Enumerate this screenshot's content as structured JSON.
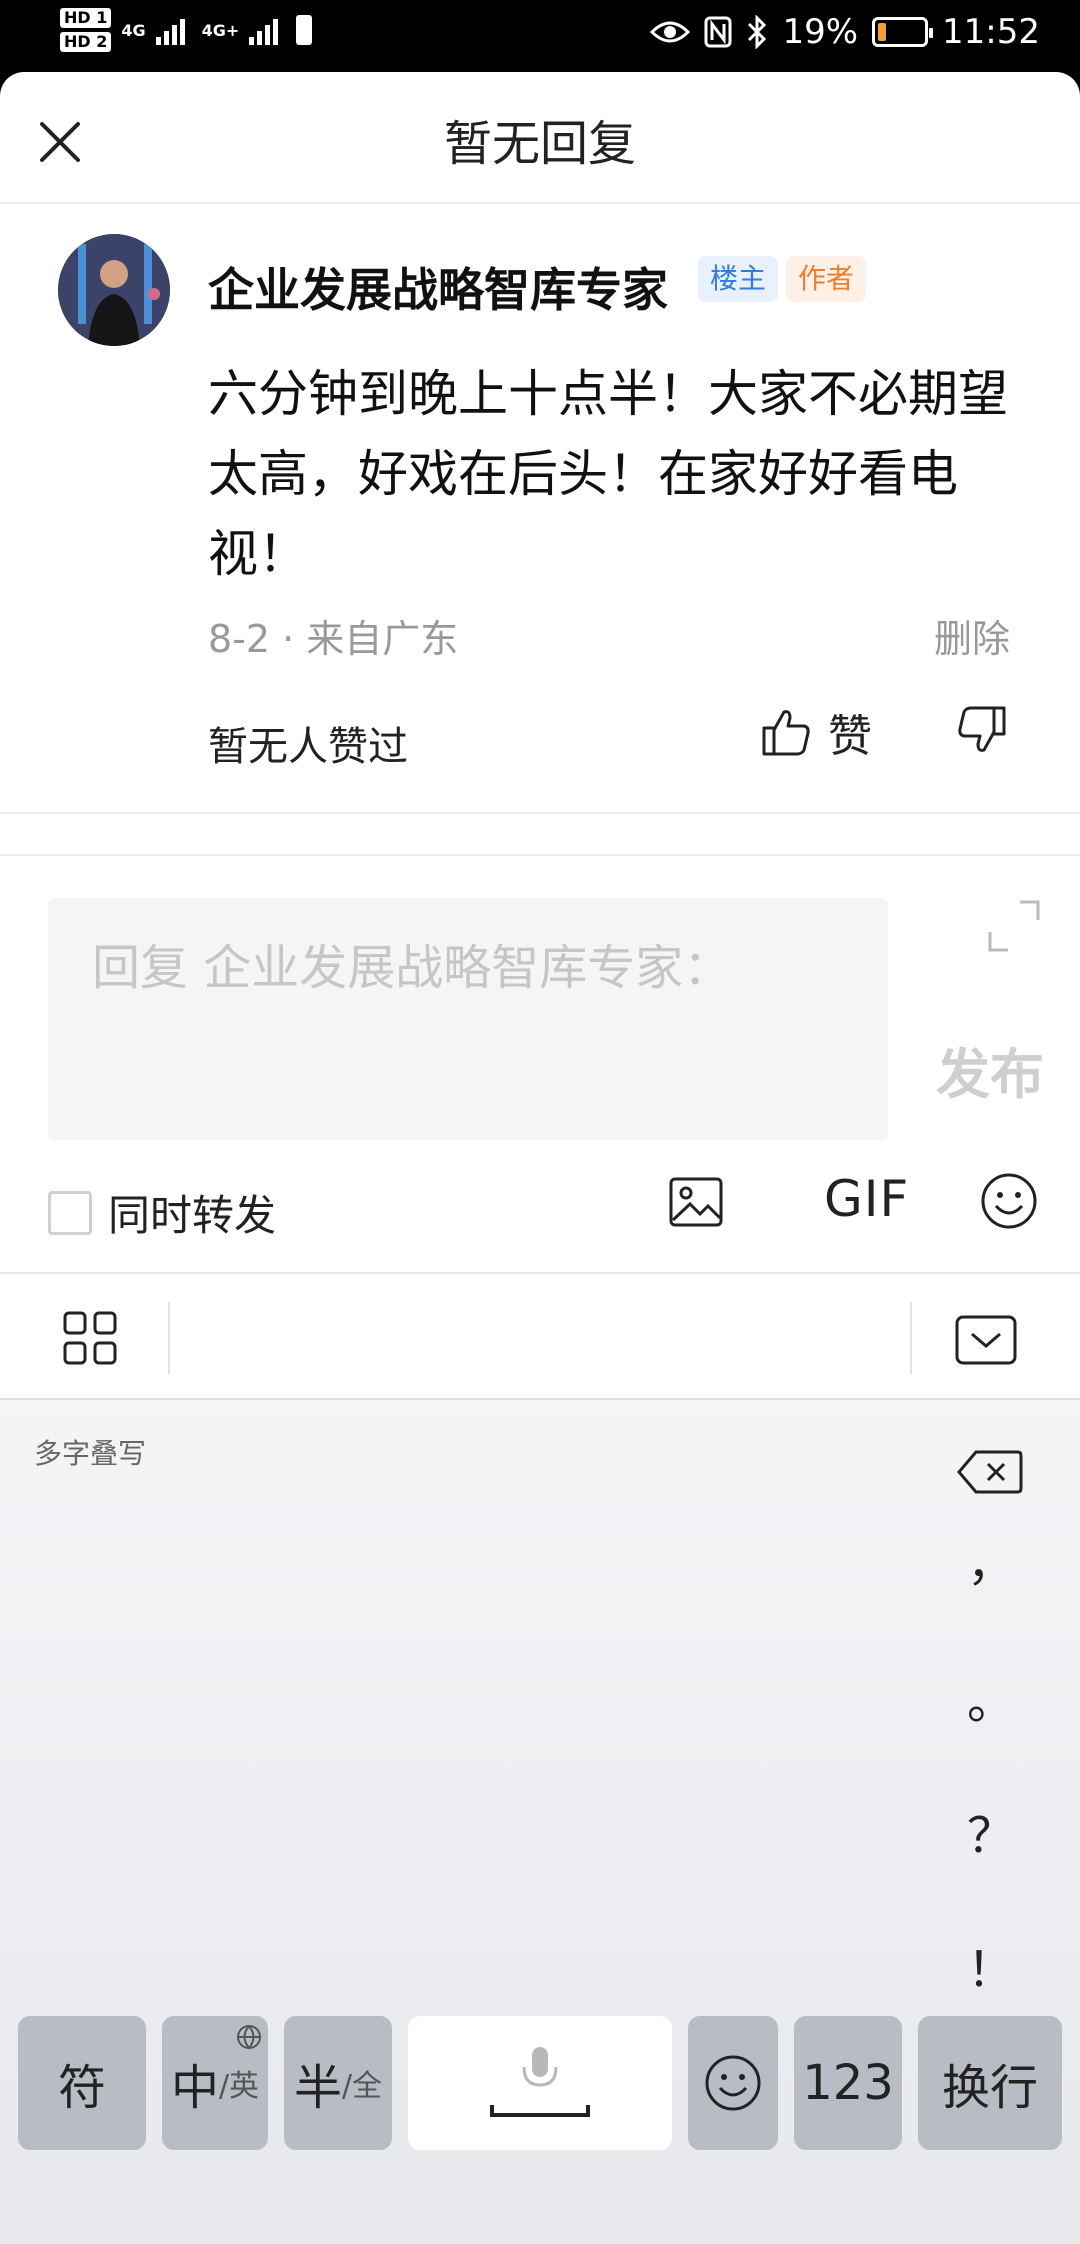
{
  "status_bar": {
    "hd1": "HD 1",
    "hd2": "HD 2",
    "net1": "4G",
    "net2": "4G+",
    "battery_percent": "19%",
    "battery_level": 0.19,
    "time": "11:52"
  },
  "header": {
    "title": "暂无回复"
  },
  "post": {
    "author": "企业发展战略智库专家",
    "badge_host": "楼主",
    "badge_author": "作者",
    "content": "六分钟到晚上十点半！大家不必期望太高，好戏在后头！在家好好看电视！",
    "meta": "8-2 · 来自广东",
    "delete_label": "删除",
    "likes_text": "暂无人赞过",
    "like_label": "赞"
  },
  "reply": {
    "placeholder": "回复 企业发展战略智库专家：",
    "publish_label": "发布",
    "forward_label": "同时转发",
    "gif_label": "GIF"
  },
  "keyboard": {
    "handwriting_label": "多字叠写",
    "punctuation": [
      "，",
      "。",
      "？",
      "！"
    ],
    "keys": {
      "symbol": "符",
      "zh": "中",
      "en": "/英",
      "half": "半",
      "full": "/全",
      "num": "123",
      "enter": "换行"
    }
  },
  "colors": {
    "host_badge": "#2f7de1",
    "author_badge": "#ef7d2b",
    "battery": "#f2a23a"
  }
}
